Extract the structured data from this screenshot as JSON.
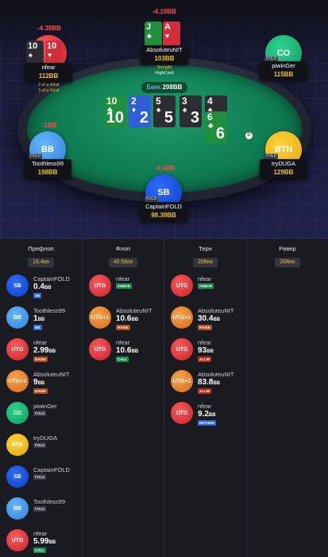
{
  "table": {
    "pot_label": "Банк",
    "pot_value": "208BB",
    "board": [
      {
        "rank": "10",
        "suit": "♣",
        "color": "club"
      },
      {
        "rank": "2",
        "suit": "♦",
        "color": "diamond"
      },
      {
        "rank": "5",
        "suit": "♠",
        "color": "spade"
      },
      {
        "rank": "3",
        "suit": "♠",
        "color": "spade"
      },
      {
        "rank": "4",
        "suit": "♠",
        "color": "spade"
      },
      {
        "rank": "6",
        "suit": "♣",
        "color": "club"
      }
    ],
    "seats": {
      "utg": {
        "label": "UTG",
        "name": "nfear",
        "stack": "112BB",
        "result": "-4.39BB",
        "hand1": "3 of a Kind",
        "hand2": "3 of a Kind",
        "cards": [
          {
            "rank": "10",
            "suit": "♠",
            "color": "spade"
          },
          {
            "rank": "10",
            "suit": "♥",
            "color": "heart"
          }
        ]
      },
      "utg1": {
        "label": "UTG+1",
        "name": "AbsoluteuNIT",
        "stack": "103BB",
        "result": "-4.19BB",
        "hand1": "Straight",
        "hand2": "HighCard",
        "cards": [
          {
            "rank": "J",
            "suit": "♣",
            "color": "club"
          },
          {
            "rank": "A",
            "suit": "♥",
            "color": "heart"
          }
        ]
      },
      "co": {
        "label": "CO",
        "name": "piwinGer",
        "stack": "115BB",
        "pos": "FOLD"
      },
      "btn": {
        "label": "BTN",
        "name": "tryDUGA",
        "stack": "129BB",
        "pos": "FOLD"
      },
      "sb": {
        "label": "SB",
        "name": "CaptainFOLD",
        "stack": "98.39BB",
        "result": "-0.4BB",
        "pos": "FOLD"
      },
      "bb": {
        "label": "BB",
        "name": "Toothless99",
        "stack": "198BB",
        "result": "-1BB",
        "pos": "FOLD"
      }
    },
    "dealer": "D"
  },
  "streets": [
    {
      "name": "Префлоп",
      "pot": "19.4",
      "unit": "BB",
      "actions": [
        {
          "pos": "SB",
          "name": "CaptainFOLD",
          "amount": "0.4",
          "unit": "BB",
          "tag": "SB"
        },
        {
          "pos": "BB",
          "name": "Toothless99",
          "amount": "1",
          "unit": "BB",
          "tag": "BB"
        },
        {
          "pos": "UTG",
          "name": "nfear",
          "amount": "2.99",
          "unit": "BB",
          "tag": "RAISE"
        },
        {
          "pos": "UTG+1",
          "name": "AbsoluteuNIT",
          "amount": "9",
          "unit": "BB",
          "tag": "RAISE"
        },
        {
          "pos": "CO",
          "name": "piwinGer",
          "amount": "",
          "unit": "",
          "tag": "FOLD"
        },
        {
          "pos": "BTN",
          "name": "tryDUGA",
          "amount": "",
          "unit": "",
          "tag": "FOLD"
        },
        {
          "pos": "SB",
          "name": "CaptainFOLD",
          "amount": "",
          "unit": "",
          "tag": "FOLD"
        },
        {
          "pos": "BB",
          "name": "Toothless99",
          "amount": "",
          "unit": "",
          "tag": "FOLD"
        },
        {
          "pos": "UTG",
          "name": "nfear",
          "amount": "5.99",
          "unit": "BB",
          "tag": "CALL"
        }
      ]
    },
    {
      "name": "Флоп",
      "pot": "40.59",
      "unit": "BB",
      "actions": [
        {
          "pos": "UTG",
          "name": "nfear",
          "amount": "",
          "unit": "",
          "tag": "CHECK"
        },
        {
          "pos": "UTG+1",
          "name": "AbsoluteuNIT",
          "amount": "10.6",
          "unit": "BB",
          "tag": "RAISE"
        },
        {
          "pos": "UTG",
          "name": "nfear",
          "amount": "10.6",
          "unit": "BB",
          "tag": "CALL"
        }
      ]
    },
    {
      "name": "Терн",
      "pot": "208",
      "unit": "BB",
      "actions": [
        {
          "pos": "UTG",
          "name": "nfear",
          "amount": "",
          "unit": "",
          "tag": "CHECK"
        },
        {
          "pos": "UTG+1",
          "name": "AbsoluteuNIT",
          "amount": "30.4",
          "unit": "BB",
          "tag": "RAISE"
        },
        {
          "pos": "UTG",
          "name": "nfear",
          "amount": "93",
          "unit": "BB",
          "tag": "ALLIN"
        },
        {
          "pos": "UTG+1",
          "name": "AbsoluteuNIT",
          "amount": "83.8",
          "unit": "BB",
          "tag": "ALLIN"
        },
        {
          "pos": "UTG",
          "name": "nfear",
          "amount": "9.2",
          "unit": "BB",
          "tag": "RETURN"
        }
      ]
    },
    {
      "name": "Ривер",
      "pot": "208",
      "unit": "BB",
      "actions": []
    }
  ]
}
